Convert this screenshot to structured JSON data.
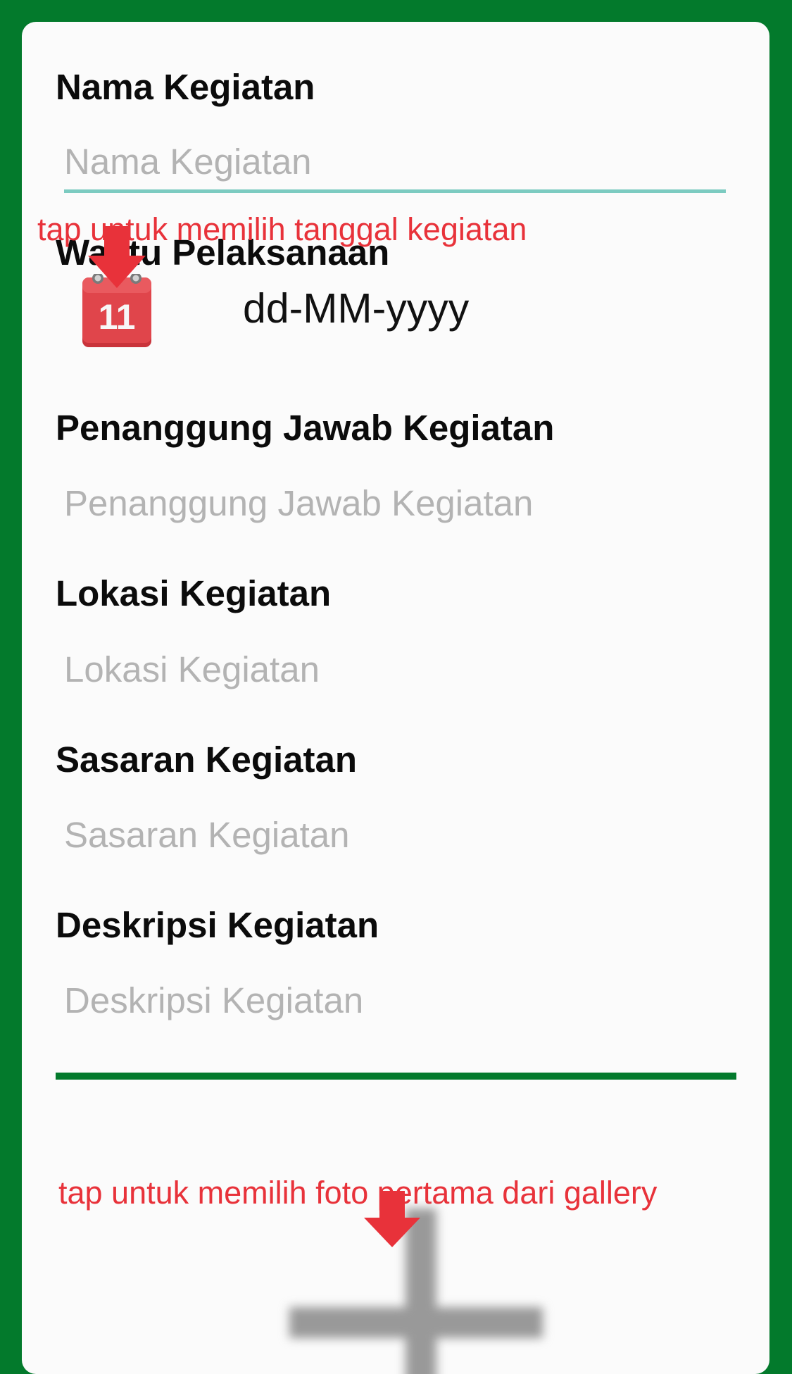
{
  "form": {
    "nama_label": "Nama Kegiatan",
    "nama_placeholder": "Nama Kegiatan",
    "waktu_label": "Waktu Pelaksanaan",
    "calendar_day": "11",
    "date_value": "dd-MM-yyyy",
    "penanggung_label": "Penanggung Jawab Kegiatan",
    "penanggung_placeholder": "Penanggung Jawab Kegiatan",
    "lokasi_label": "Lokasi Kegiatan",
    "lokasi_placeholder": "Lokasi Kegiatan",
    "sasaran_label": "Sasaran Kegiatan",
    "sasaran_placeholder": "Sasaran Kegiatan",
    "deskripsi_label": "Deskripsi Kegiatan",
    "deskripsi_placeholder": "Deskripsi Kegiatan"
  },
  "hints": {
    "date": "tap untuk memilih tanggal kegiatan",
    "photo": "tap untuk memilih foto pertama dari gallery"
  },
  "icons": {
    "calendar": "calendar-icon",
    "arrow": "down-arrow-icon",
    "add_photo": "plus-icon"
  },
  "colors": {
    "background": "#037a2c",
    "card": "#fbfbfb",
    "hint_text": "#e8323a",
    "focus_underline": "#7ccbc1",
    "placeholder": "#b3b3b3",
    "calendar_red": "#e0454b"
  }
}
